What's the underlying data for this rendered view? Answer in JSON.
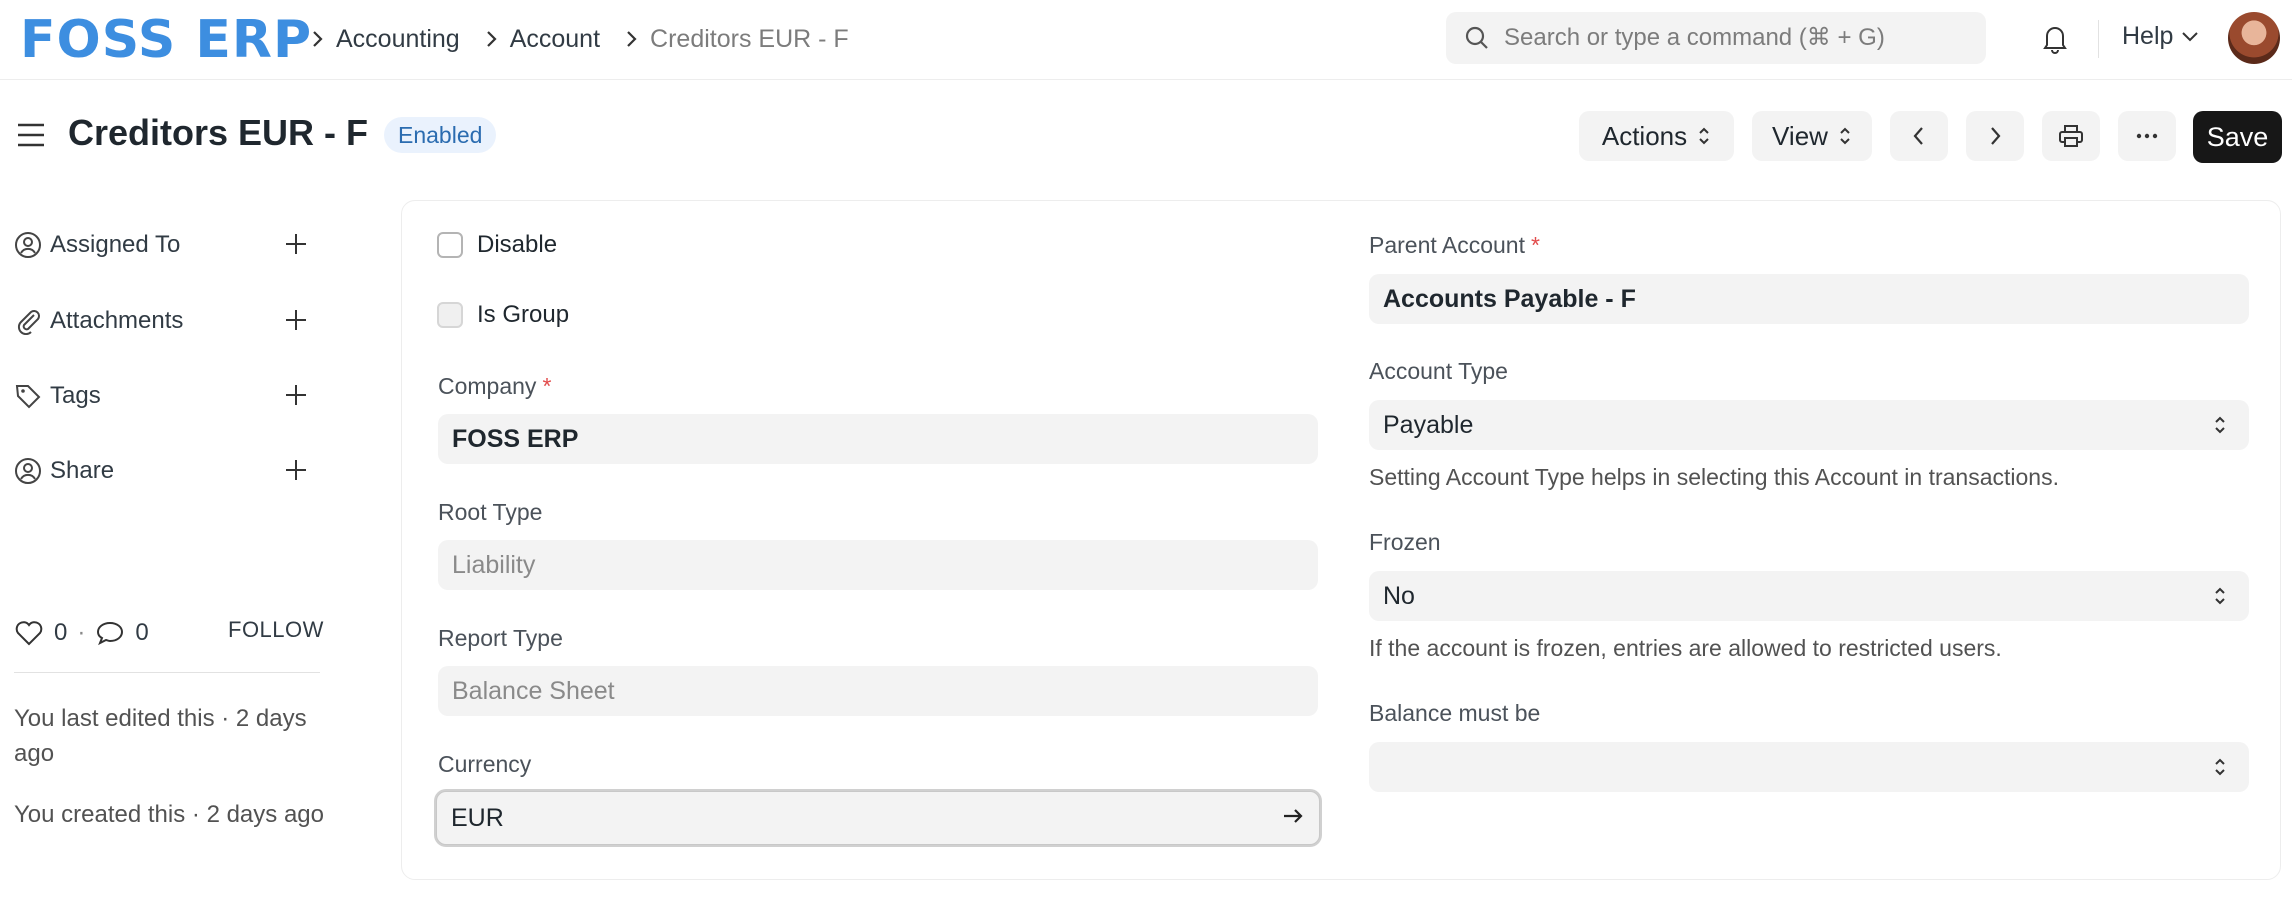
{
  "navbar": {
    "logo": "FOSS ERP",
    "breadcrumbs": [
      "Accounting",
      "Account",
      "Creditors EUR - F"
    ],
    "search_placeholder": "Search or type a command (⌘ + G)",
    "help_label": "Help"
  },
  "page": {
    "title": "Creditors EUR - F",
    "status_badge": "Enabled",
    "actions_label": "Actions",
    "view_label": "View",
    "save_label": "Save"
  },
  "sidebar": {
    "items": [
      {
        "label": "Assigned To",
        "icon": "user-assign-icon"
      },
      {
        "label": "Attachments",
        "icon": "paperclip-icon"
      },
      {
        "label": "Tags",
        "icon": "tag-icon"
      },
      {
        "label": "Share",
        "icon": "share-user-icon"
      }
    ],
    "likes": "0",
    "comments": "0",
    "separator": "·",
    "follow_label": "FOLLOW",
    "last_edited": "You last edited this · 2 days ago",
    "created": "You created this · 2 days ago"
  },
  "form": {
    "disable_label": "Disable",
    "is_group_label": "Is Group",
    "company": {
      "label": "Company",
      "value": "FOSS ERP",
      "required": "*"
    },
    "root_type": {
      "label": "Root Type",
      "value": "Liability"
    },
    "report_type": {
      "label": "Report Type",
      "value": "Balance Sheet"
    },
    "currency": {
      "label": "Currency",
      "value": "EUR"
    },
    "parent_account": {
      "label": "Parent Account",
      "value": "Accounts Payable - F",
      "required": "*"
    },
    "account_type": {
      "label": "Account Type",
      "value": "Payable",
      "hint": "Setting Account Type helps in selecting this Account in transactions."
    },
    "frozen": {
      "label": "Frozen",
      "value": "No",
      "hint": "If the account is frozen, entries are allowed to restricted users."
    },
    "balance_must_be": {
      "label": "Balance must be",
      "value": ""
    }
  }
}
